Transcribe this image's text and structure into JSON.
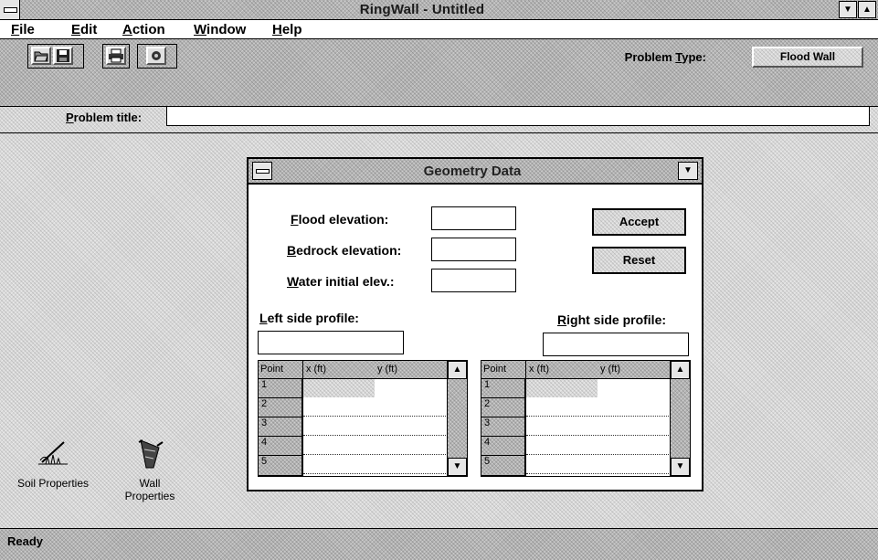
{
  "window": {
    "title": "RingWall - Untitled",
    "dropdown_arrow": "▼",
    "restore_arrow": "▲"
  },
  "menu": [
    {
      "key": "F",
      "rest": "ile"
    },
    {
      "key": "E",
      "rest": "dit"
    },
    {
      "key": "A",
      "rest": "ction"
    },
    {
      "key": "W",
      "rest": "indow"
    },
    {
      "key": "H",
      "rest": "elp"
    }
  ],
  "toolbar": {
    "icons": [
      "open-folder-icon",
      "save-disk-icon",
      "print-icon",
      "settings-icon"
    ],
    "problem_type_label_pre": "Problem ",
    "problem_type_label_key": "T",
    "problem_type_label_post": "ype:",
    "problem_type_value": "Flood Wall",
    "problem_title_label_key": "P",
    "problem_title_label_rest": "roblem title:",
    "problem_title_value": ""
  },
  "desktop": {
    "soil_label": "Soil Properties",
    "wall_label_1": "Wall",
    "wall_label_2": "Properties"
  },
  "status": {
    "text": "Ready"
  },
  "dialog": {
    "title": "Geometry Data",
    "dropdown_arrow": "▼",
    "flood_key": "F",
    "flood_rest": "lood elevation:",
    "bedrock_key": "B",
    "bedrock_rest": "edrock elevation:",
    "water_key": "W",
    "water_rest": "ater initial elev.:",
    "flood_value": "",
    "bedrock_value": "",
    "water_value": "",
    "accept": "Accept",
    "reset": "Reset",
    "left_key": "L",
    "left_rest": "eft  side profile:",
    "right_key": "R",
    "right_rest": "ight  side profile:",
    "left_profile_value": "",
    "right_profile_value": "",
    "grid_headers": [
      "Point",
      "x (ft)",
      "y (ft)"
    ],
    "rows": [
      "1",
      "2",
      "3",
      "4",
      "5"
    ],
    "scroll_up": "▲",
    "scroll_down": "▼"
  }
}
